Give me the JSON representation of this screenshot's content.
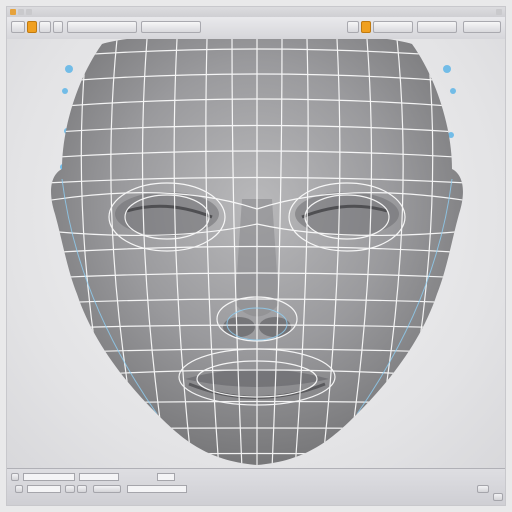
{
  "app": {
    "accent_color": "#f0a020",
    "mesh_color": "#ffffff",
    "scatter_color": "#5fb6e8"
  },
  "toolbar": {
    "icons": [
      "menu-icon",
      "orange-accent-icon",
      "view-icon",
      "grid-icon",
      "settings-icon"
    ]
  },
  "viewport": {
    "content": "3d-face-wireframe-mesh"
  },
  "statusbar": {
    "icons": [
      "play-icon",
      "stop-icon",
      "record-icon",
      "zoom-icon",
      "pan-icon"
    ]
  }
}
